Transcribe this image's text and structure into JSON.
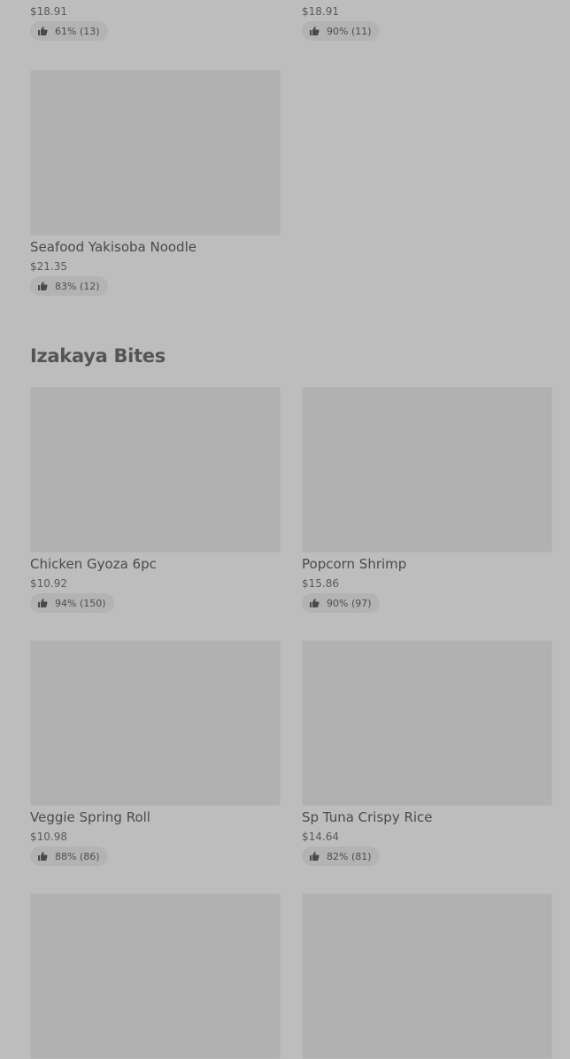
{
  "top_row": [
    {
      "price": "$18.91",
      "rating": "61% (13)"
    },
    {
      "price": "$18.91",
      "rating": "90% (11)"
    }
  ],
  "seafood": {
    "name": "Seafood Yakisoba Noodle",
    "price": "$21.35",
    "rating": "83% (12)"
  },
  "section": {
    "title": "Izakaya Bites"
  },
  "items": [
    {
      "name": "Chicken Gyoza 6pc",
      "price": "$10.92",
      "rating": "94% (150)"
    },
    {
      "name": "Popcorn Shrimp",
      "price": "$15.86",
      "rating": "90% (97)"
    },
    {
      "name": "Veggie Spring Roll",
      "price": "$10.98",
      "rating": "88% (86)"
    },
    {
      "name": "Sp Tuna Crispy Rice",
      "price": "$14.64",
      "rating": "82% (81)"
    }
  ],
  "icons": {
    "rating": "thumbs-up-icon"
  }
}
